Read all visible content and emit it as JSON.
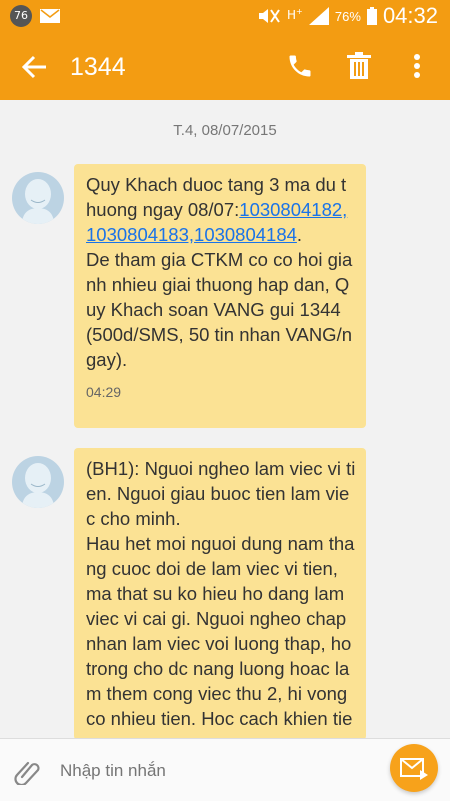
{
  "status_bar": {
    "notification_count": "76",
    "battery": "76%",
    "time": "04:32",
    "icons": [
      "mail-icon",
      "mute-icon",
      "hplus-icon",
      "signal-icon",
      "battery-icon"
    ]
  },
  "app_bar": {
    "title": "1344",
    "icons": [
      "back-arrow-icon",
      "phone-icon",
      "trash-icon",
      "more-vert-icon"
    ],
    "color": "#f39c12"
  },
  "conversation": {
    "date": "T.4, 08/07/2015",
    "messages": [
      {
        "text_before": "Quy Khach duoc tang 3 ma du thuong ngay 08/07:",
        "links": "1030804182,1030804183,1030804184",
        "text_after": ".\nDe tham gia CTKM co co hoi gianh nhieu giai thuong hap dan, Quy Khach soan VANG gui 1344 (500d/SMS, 50 tin nhan VANG/ngay).",
        "time": "04:29"
      },
      {
        "text": "(BH1): Nguoi ngheo lam viec vi tien. Nguoi giau buoc tien lam viec cho minh.\nHau het moi nguoi dung nam thang cuoc doi de lam viec vi tien, ma that su ko hieu ho dang lam viec vi cai gi. Nguoi ngheo chap nhan lam viec voi luong thap, ho trong cho dc nang luong hoac lam them cong viec thu 2, hi vong co nhieu tien. Hoc cach khien tien"
      }
    ],
    "bubble_color": "#fbe294"
  },
  "composer": {
    "placeholder": "Nhập tin nhắn",
    "icons": [
      "attach-icon",
      "send-icon"
    ],
    "send_color": "#f7a21b"
  }
}
